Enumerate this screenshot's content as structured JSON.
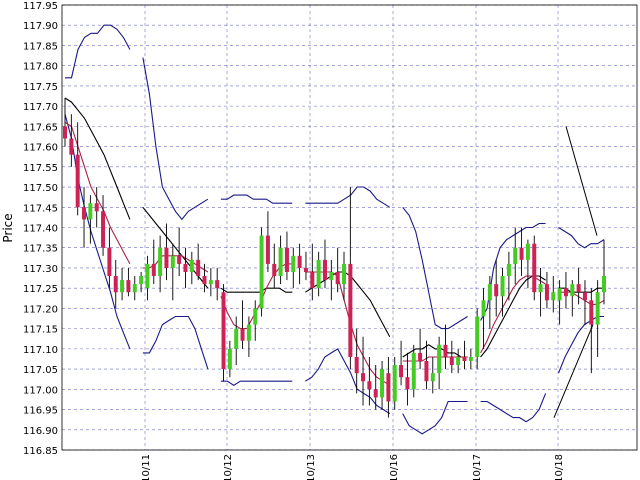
{
  "chart_data": {
    "type": "candlestick",
    "ylabel": "Price",
    "ylim": [
      116.85,
      117.95
    ],
    "y_ticks": [
      "116.85",
      "116.90",
      "116.95",
      "117.00",
      "117.05",
      "117.10",
      "117.15",
      "117.20",
      "117.25",
      "117.30",
      "117.35",
      "117.40",
      "117.45",
      "117.50",
      "117.55",
      "117.60",
      "117.65",
      "117.70",
      "117.75",
      "117.80",
      "117.85",
      "117.90",
      "117.95"
    ],
    "x_ticks": [
      "10/11",
      "10/12",
      "10/13",
      "10/16",
      "10/17",
      "10/18"
    ],
    "grid": true,
    "colors": {
      "up": "#44cc22",
      "down": "#cc2255",
      "wick": "#000000",
      "bollinger": "#1a1a88",
      "ma_fast": "#aa2244",
      "ma_slow": "#000000",
      "grid": "#3333aa"
    },
    "series": [
      {
        "style": "candles",
        "values": [
          [
            117.65,
            117.72,
            117.6,
            117.62
          ],
          [
            117.62,
            117.68,
            117.55,
            117.58
          ],
          [
            117.58,
            117.66,
            117.43,
            117.45
          ],
          [
            117.45,
            117.5,
            117.35,
            117.42
          ],
          [
            117.42,
            117.48,
            117.36,
            117.46
          ],
          [
            117.46,
            117.5,
            117.4,
            117.44
          ],
          [
            117.44,
            117.48,
            117.33,
            117.35
          ],
          [
            117.35,
            117.4,
            117.25,
            117.28
          ],
          [
            117.28,
            117.32,
            117.2,
            117.24
          ],
          [
            117.24,
            117.3,
            117.22,
            117.27
          ],
          [
            117.27,
            117.3,
            117.23,
            117.24
          ],
          [
            117.24,
            117.28,
            117.22,
            117.26
          ],
          [
            117.26,
            117.29,
            117.24,
            117.28
          ],
          [
            117.25,
            117.33,
            117.22,
            117.31
          ],
          [
            117.31,
            117.37,
            117.26,
            117.28
          ],
          [
            117.28,
            117.38,
            117.24,
            117.35
          ],
          [
            117.35,
            117.41,
            117.27,
            117.3
          ],
          [
            117.3,
            117.36,
            117.22,
            117.33
          ],
          [
            117.33,
            117.4,
            117.28,
            117.31
          ],
          [
            117.31,
            117.35,
            117.25,
            117.29
          ],
          [
            117.29,
            117.34,
            117.26,
            117.32
          ],
          [
            117.32,
            117.36,
            117.27,
            117.28
          ],
          [
            117.28,
            117.31,
            117.24,
            117.26
          ],
          [
            117.26,
            117.3,
            117.23,
            117.27
          ],
          [
            117.27,
            117.3,
            117.22,
            117.25
          ],
          [
            117.24,
            117.26,
            117.02,
            117.05
          ],
          [
            117.05,
            117.12,
            117.03,
            117.1
          ],
          [
            117.1,
            117.18,
            117.06,
            117.15
          ],
          [
            117.15,
            117.22,
            117.1,
            117.12
          ],
          [
            117.12,
            117.18,
            117.08,
            117.16
          ],
          [
            117.16,
            117.22,
            117.12,
            117.2
          ],
          [
            117.2,
            117.4,
            117.18,
            117.38
          ],
          [
            117.38,
            117.44,
            117.29,
            117.31
          ],
          [
            117.31,
            117.36,
            117.25,
            117.28
          ],
          [
            117.28,
            117.38,
            117.26,
            117.35
          ],
          [
            117.35,
            117.39,
            117.27,
            117.29
          ],
          [
            117.29,
            117.35,
            117.25,
            117.33
          ],
          [
            117.33,
            117.36,
            117.26,
            117.3
          ],
          [
            117.3,
            117.34,
            117.27,
            117.29
          ],
          [
            117.29,
            117.36,
            117.22,
            117.25
          ],
          [
            117.25,
            117.34,
            117.23,
            117.32
          ],
          [
            117.32,
            117.37,
            117.25,
            117.27
          ],
          [
            117.27,
            117.32,
            117.22,
            117.29
          ],
          [
            117.29,
            117.35,
            117.24,
            117.26
          ],
          [
            117.26,
            117.34,
            117.22,
            117.31
          ],
          [
            117.31,
            117.5,
            117.05,
            117.08
          ],
          [
            117.08,
            117.15,
            116.99,
            117.04
          ],
          [
            117.04,
            117.13,
            116.96,
            117.02
          ],
          [
            117.02,
            117.08,
            116.96,
            117.0
          ],
          [
            117.0,
            117.06,
            116.95,
            116.98
          ],
          [
            116.98,
            117.07,
            116.95,
            117.05
          ],
          [
            117.04,
            117.08,
            116.93,
            116.97
          ],
          [
            116.97,
            117.08,
            116.95,
            117.06
          ],
          [
            117.06,
            117.12,
            117.01,
            117.03
          ],
          [
            117.03,
            117.09,
            116.96,
            117.0
          ],
          [
            117.0,
            117.11,
            116.98,
            117.09
          ],
          [
            117.09,
            117.15,
            117.05,
            117.07
          ],
          [
            117.07,
            117.12,
            117.0,
            117.02
          ],
          [
            117.02,
            117.08,
            116.99,
            117.04
          ],
          [
            117.04,
            117.13,
            117.0,
            117.11
          ],
          [
            117.11,
            117.16,
            117.05,
            117.08
          ],
          [
            117.08,
            117.12,
            117.04,
            117.06
          ],
          [
            117.06,
            117.1,
            117.04,
            117.08
          ],
          [
            117.08,
            117.12,
            117.05,
            117.07
          ],
          [
            117.07,
            117.1,
            117.05,
            117.08
          ],
          [
            117.08,
            117.2,
            117.05,
            117.18
          ],
          [
            117.18,
            117.25,
            117.1,
            117.22
          ],
          [
            117.22,
            117.28,
            117.15,
            117.26
          ],
          [
            117.26,
            117.32,
            117.18,
            117.23
          ],
          [
            117.23,
            117.3,
            117.18,
            117.28
          ],
          [
            117.28,
            117.34,
            117.22,
            117.31
          ],
          [
            117.31,
            117.4,
            117.26,
            117.35
          ],
          [
            117.35,
            117.4,
            117.28,
            117.32
          ],
          [
            117.32,
            117.37,
            117.25,
            117.36
          ],
          [
            117.36,
            117.38,
            117.22,
            117.24
          ],
          [
            117.24,
            117.3,
            117.18,
            117.26
          ],
          [
            117.26,
            117.29,
            117.2,
            117.22
          ],
          [
            117.22,
            117.28,
            117.19,
            117.24
          ],
          [
            117.22,
            117.27,
            117.16,
            117.25
          ],
          [
            117.25,
            117.29,
            117.2,
            117.23
          ],
          [
            117.23,
            117.27,
            117.18,
            117.26
          ],
          [
            117.26,
            117.3,
            117.21,
            117.24
          ],
          [
            117.24,
            117.27,
            117.16,
            117.22
          ],
          [
            117.22,
            117.25,
            117.04,
            117.16
          ],
          [
            117.16,
            117.27,
            117.08,
            117.24
          ],
          [
            117.24,
            117.37,
            117.21,
            117.28
          ]
        ]
      },
      {
        "style": "bollinger_upper",
        "values": [
          117.77,
          117.77,
          117.84,
          117.87,
          117.88,
          117.88,
          117.9,
          117.9,
          117.89,
          117.87,
          117.84,
          null,
          117.82,
          117.73,
          117.6,
          117.5,
          117.47,
          117.44,
          117.42,
          117.44,
          117.45,
          117.46,
          117.47,
          null,
          117.47,
          117.47,
          117.48,
          117.48,
          117.48,
          117.47,
          117.47,
          117.47,
          117.46,
          117.46,
          117.46,
          117.46,
          null,
          117.46,
          117.46,
          117.46,
          117.46,
          117.46,
          117.46,
          117.47,
          117.48,
          117.5,
          117.5,
          117.49,
          117.47,
          117.46,
          117.45,
          null,
          117.45,
          117.43,
          117.39,
          117.32,
          117.24,
          117.16,
          117.15,
          117.15,
          117.16,
          117.17,
          117.18,
          null,
          117.17,
          117.2,
          117.3,
          117.35,
          117.37,
          117.38,
          117.39,
          117.4,
          117.4,
          117.41,
          117.41,
          null,
          117.4,
          117.39,
          117.38,
          117.36,
          117.35,
          117.36,
          117.36,
          117.37
        ]
      },
      {
        "style": "bollinger_lower",
        "values": [
          117.68,
          117.62,
          117.52,
          117.45,
          117.39,
          117.34,
          117.29,
          117.24,
          117.18,
          117.14,
          117.1,
          null,
          117.09,
          117.09,
          117.12,
          117.16,
          117.17,
          117.18,
          117.18,
          117.18,
          117.15,
          117.1,
          117.05,
          null,
          117.02,
          117.02,
          117.01,
          117.02,
          117.02,
          117.02,
          117.02,
          117.02,
          117.02,
          117.02,
          117.02,
          117.02,
          null,
          117.02,
          117.03,
          117.05,
          117.08,
          117.09,
          117.1,
          117.07,
          117.04,
          117.0,
          116.99,
          116.98,
          116.96,
          116.95,
          116.94,
          null,
          116.94,
          116.91,
          116.9,
          116.89,
          116.9,
          116.91,
          116.93,
          116.97,
          116.97,
          116.97,
          116.97,
          null,
          116.97,
          116.97,
          116.96,
          116.95,
          116.94,
          116.93,
          116.93,
          116.92,
          116.93,
          116.95,
          116.99,
          null,
          117.04,
          117.08,
          117.11,
          117.14,
          117.16,
          117.17,
          117.18,
          117.18
        ]
      },
      {
        "style": "ma_slow",
        "values": [
          117.72,
          117.71,
          117.69,
          117.67,
          117.64,
          117.61,
          117.58,
          117.54,
          117.5,
          117.46,
          117.42,
          null,
          117.45,
          117.43,
          117.41,
          117.39,
          117.37,
          117.35,
          117.33,
          117.31,
          117.29,
          117.27,
          117.25,
          null,
          117.25,
          117.24,
          117.24,
          117.24,
          117.24,
          117.24,
          117.24,
          117.25,
          117.25,
          117.25,
          117.24,
          117.24,
          null,
          117.24,
          117.25,
          117.26,
          117.27,
          117.28,
          117.29,
          117.29,
          117.28,
          117.26,
          117.24,
          117.22,
          117.19,
          117.16,
          117.13,
          null,
          117.08,
          117.09,
          117.1,
          117.1,
          117.11,
          117.1,
          117.1,
          117.09,
          117.09,
          117.08,
          117.08,
          null,
          117.08,
          117.1,
          117.13,
          117.16,
          117.19,
          117.22,
          117.25,
          117.27,
          117.28,
          117.28,
          117.27,
          null,
          117.25,
          117.25,
          117.24,
          117.24,
          117.24,
          117.24,
          117.25,
          117.25
        ]
      },
      {
        "style": "ma_fast",
        "values": [
          117.66,
          117.65,
          117.6,
          117.55,
          117.5,
          117.47,
          117.44,
          117.4,
          117.37,
          117.34,
          117.31,
          null,
          117.3,
          117.3,
          117.31,
          117.33,
          117.33,
          117.33,
          117.33,
          117.32,
          117.31,
          117.3,
          117.29,
          null,
          117.23,
          117.19,
          117.16,
          117.15,
          117.15,
          117.18,
          117.21,
          117.25,
          117.28,
          117.3,
          117.31,
          117.31,
          null,
          117.29,
          117.29,
          117.29,
          117.29,
          117.29,
          117.28,
          117.22,
          117.16,
          117.11,
          117.08,
          117.05,
          117.03,
          117.02,
          117.01,
          null,
          117.07,
          117.07,
          117.07,
          117.07,
          117.08,
          117.08,
          117.08,
          117.08,
          117.08,
          117.08,
          117.08,
          null,
          117.09,
          117.12,
          117.16,
          117.19,
          117.22,
          117.25,
          117.27,
          117.28,
          117.28,
          117.27,
          117.26,
          null,
          117.24,
          117.24,
          117.24,
          117.23,
          117.22,
          117.21,
          117.21,
          117.22
        ]
      }
    ],
    "trendlines": [
      {
        "from": [
          "10/18",
          117.65
        ],
        "to": [
          "10/18",
          117.38
        ]
      },
      {
        "from": [
          "10/18",
          116.93
        ],
        "to": [
          "10/18",
          117.16
        ]
      }
    ]
  }
}
